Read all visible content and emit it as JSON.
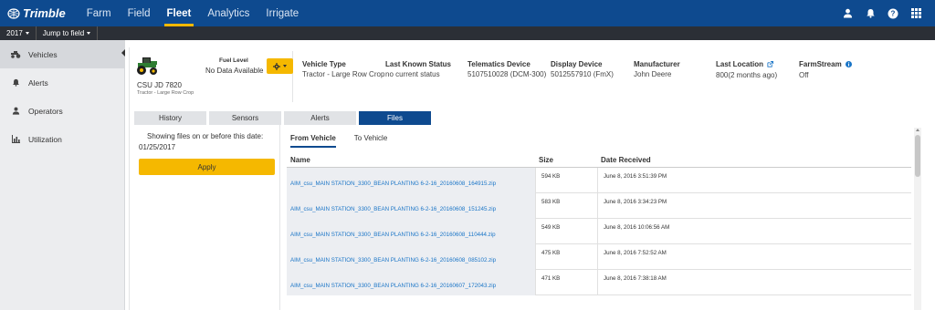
{
  "brand": {
    "name": "Trimble"
  },
  "nav": {
    "items": [
      {
        "label": "Farm"
      },
      {
        "label": "Field"
      },
      {
        "label": "Fleet"
      },
      {
        "label": "Analytics"
      },
      {
        "label": "Irrigate"
      }
    ],
    "active": "Fleet"
  },
  "top_icons": [
    "user-icon",
    "bell-icon",
    "help-icon",
    "apps-grid-icon"
  ],
  "subbar": {
    "year": "2017",
    "jump": "Jump to field"
  },
  "sidebar": {
    "items": [
      {
        "label": "Vehicles",
        "icon": "tractor-icon"
      },
      {
        "label": "Alerts",
        "icon": "bell-icon"
      },
      {
        "label": "Operators",
        "icon": "user-icon"
      },
      {
        "label": "Utilization",
        "icon": "bar-chart-icon"
      }
    ]
  },
  "vehicle": {
    "name": "CSU JD 7820",
    "type_sub": "Tractor - Large Row Crop",
    "fuel_label": "Fuel Level",
    "fuel_value": "No Data Available"
  },
  "info": {
    "vehicle_type": {
      "label": "Vehicle Type",
      "value": "Tractor - Large Row Crop"
    },
    "last_status": {
      "label": "Last Known Status",
      "value": "no current status"
    },
    "telematics": {
      "label": "Telematics Device",
      "value": "5107510028 (DCM-300)"
    },
    "display": {
      "label": "Display Device",
      "value": "5012557910 (FmX)"
    },
    "manufacturer": {
      "label": "Manufacturer",
      "value": "John Deere"
    },
    "location": {
      "label": "Last Location",
      "value": "800(2 months ago)"
    },
    "farmstream": {
      "label": "FarmStream",
      "value": "Off"
    }
  },
  "tabs": [
    {
      "label": "History"
    },
    {
      "label": "Sensors"
    },
    {
      "label": "Alerts"
    },
    {
      "label": "Files"
    }
  ],
  "filter": {
    "title": "Showing files on or before this date:",
    "date": "01/25/2017",
    "apply_label": "Apply"
  },
  "files": {
    "subtabs": [
      {
        "label": "From Vehicle"
      },
      {
        "label": "To Vehicle"
      }
    ],
    "columns": {
      "name": "Name",
      "size": "Size",
      "date": "Date Received"
    },
    "rows": [
      {
        "name": "AIM_csu_MAIN STATION_3300_BEAN PLANTING 6-2-16_20160608_164915.zip",
        "size": "594 KB",
        "date": "June 8, 2016 3:51:39 PM"
      },
      {
        "name": "AIM_csu_MAIN STATION_3300_BEAN PLANTING 6-2-16_20160608_151245.zip",
        "size": "583 KB",
        "date": "June 8, 2016 3:34:23 PM"
      },
      {
        "name": "AIM_csu_MAIN STATION_3300_BEAN PLANTING 6-2-16_20160608_110444.zip",
        "size": "549 KB",
        "date": "June 8, 2016 10:06:56 AM"
      },
      {
        "name": "AIM_csu_MAIN STATION_3300_BEAN PLANTING 6-2-16_20160608_085102.zip",
        "size": "475 KB",
        "date": "June 8, 2016 7:52:52 AM"
      },
      {
        "name": "AIM_csu_MAIN STATION_3300_BEAN PLANTING 6-2-16_20160607_172043.zip",
        "size": "471 KB",
        "date": "June 8, 2016 7:38:18 AM"
      }
    ]
  },
  "colors": {
    "nav_bg": "#0e4a8f",
    "accent": "#f5b800",
    "link": "#1a75c7"
  }
}
